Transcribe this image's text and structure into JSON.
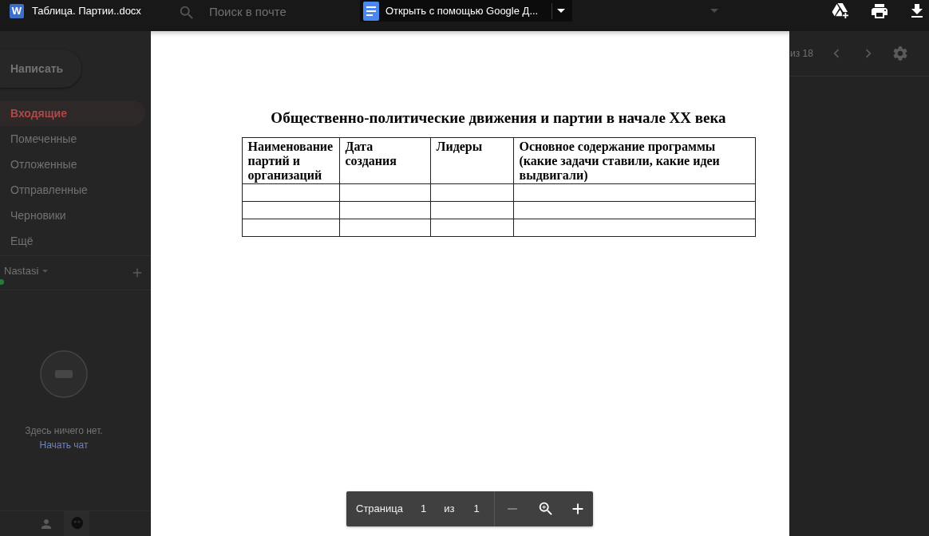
{
  "viewer_bar": {
    "file_badge": "W",
    "file_name": "Таблица. Партии..docx",
    "open_with": "Открыть с помощью Google Д..."
  },
  "mail": {
    "search_placeholder": "Поиск в почте",
    "compose": "Написать",
    "folders": [
      {
        "label": "Входящие",
        "selected": true
      },
      {
        "label": "Помеченные",
        "selected": false
      },
      {
        "label": "Отложенные",
        "selected": false
      },
      {
        "label": "Отправленные",
        "selected": false
      },
      {
        "label": "Черновики",
        "selected": false
      },
      {
        "label": "Ещё",
        "selected": false
      }
    ],
    "account": {
      "name": "Nastasi",
      "online": true
    },
    "chat": {
      "empty_text": "Здесь ничего нет.",
      "start_link": "Начать чат"
    },
    "pager": "из 18"
  },
  "document": {
    "title": "Общественно-политические движения и партии в начале XX века",
    "table": {
      "columns": [
        "Наименование партий и организаций",
        "Дата создания",
        "Лидеры",
        "Основное содержание программы (какие задачи ставили, какие идеи выдвигали)"
      ],
      "rows": [
        {
          "kind": "blank"
        },
        {
          "kind": "blank"
        },
        {
          "kind": "blank"
        }
      ]
    }
  },
  "page_controls": {
    "label": "Страница",
    "current": "1",
    "separator": "из",
    "total": "1",
    "zoom_out_disabled": true
  }
}
